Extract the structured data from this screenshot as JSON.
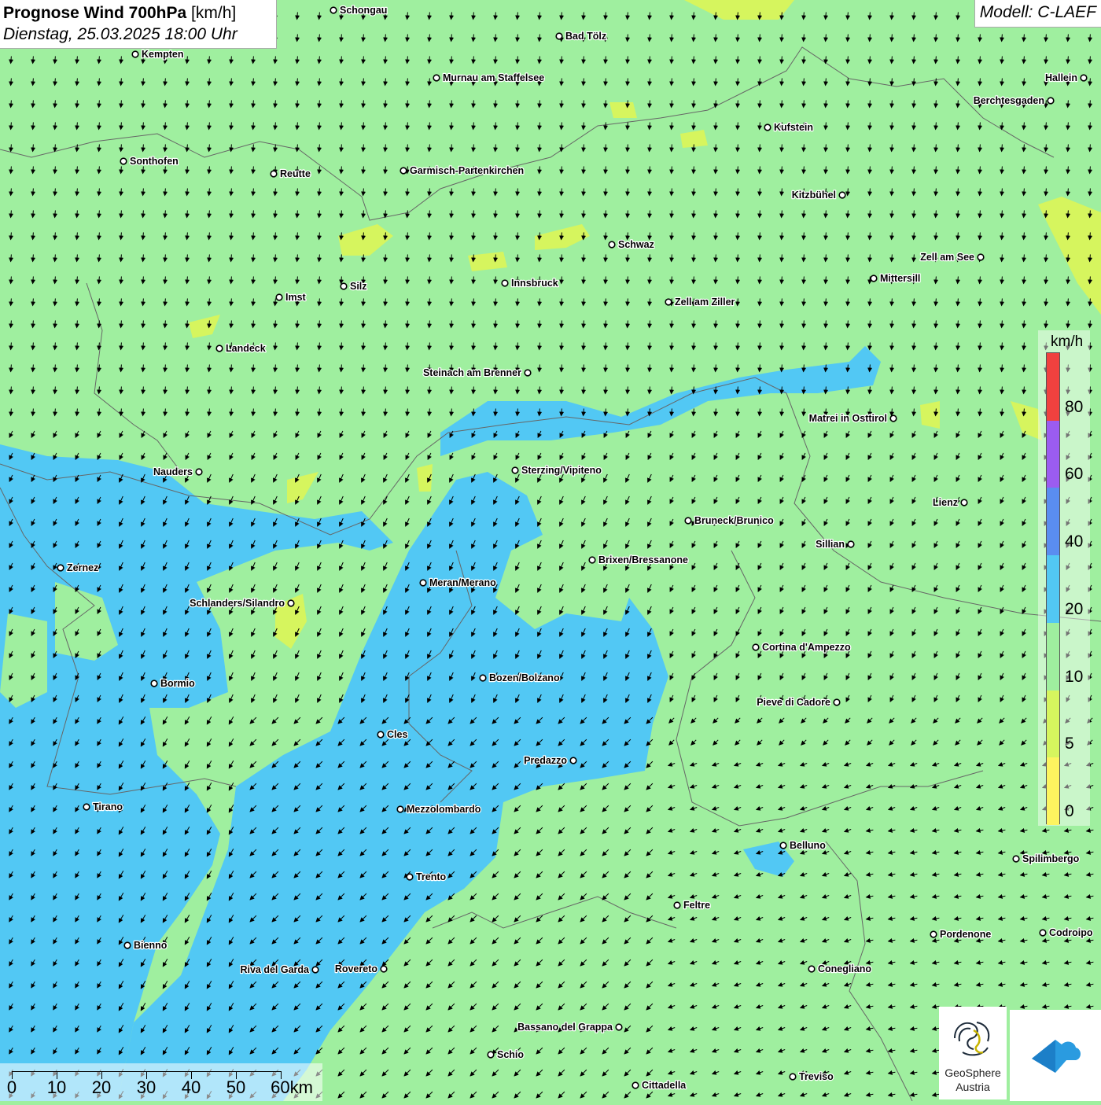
{
  "header": {
    "title_bold": "Prognose Wind 700hPa",
    "title_unit": "[km/h]",
    "datetime": "Dienstag, 25.03.2025 18:00 Uhr",
    "model": "Modell: C-LAEF"
  },
  "legend": {
    "unit": "km/h",
    "levels": [
      {
        "label": "0",
        "color": "#fdf45f"
      },
      {
        "label": "5",
        "color": "#d6f55e"
      },
      {
        "label": "10",
        "color": "#9fef9f"
      },
      {
        "label": "20",
        "color": "#52c8f4"
      },
      {
        "label": "40",
        "color": "#5a8df0"
      },
      {
        "label": "60",
        "color": "#9b5cf0"
      },
      {
        "label": "80",
        "color": "#f0413f"
      }
    ]
  },
  "scalebar": {
    "ticks": [
      "0",
      "10",
      "20",
      "30",
      "40",
      "50",
      "60km"
    ]
  },
  "cities": [
    {
      "name": "Schongau"
    },
    {
      "name": "Bad Tölz"
    },
    {
      "name": "Kempten"
    },
    {
      "name": "Murnau am Staffelsee"
    },
    {
      "name": "Hallein"
    },
    {
      "name": "Berchtesgaden"
    },
    {
      "name": "Kufstein"
    },
    {
      "name": "Sonthofen"
    },
    {
      "name": "Reutte"
    },
    {
      "name": "Garmisch-Partenkirchen"
    },
    {
      "name": "Kitzbühel"
    },
    {
      "name": "Schwaz"
    },
    {
      "name": "Zell am See"
    },
    {
      "name": "Mittersill"
    },
    {
      "name": "Innsbruck"
    },
    {
      "name": "Silz"
    },
    {
      "name": "Imst"
    },
    {
      "name": "Zell am Ziller"
    },
    {
      "name": "Landeck"
    },
    {
      "name": "Steinach am Brenner"
    },
    {
      "name": "Matrei in Osttirol"
    },
    {
      "name": "Nauders"
    },
    {
      "name": "Sterzing/Vipiteno"
    },
    {
      "name": "Lienz"
    },
    {
      "name": "Bruneck/Brunico"
    },
    {
      "name": "Sillian"
    },
    {
      "name": "Brixen/Bressanone"
    },
    {
      "name": "Zernez"
    },
    {
      "name": "Meran/Merano"
    },
    {
      "name": "Schlanders/Silandro"
    },
    {
      "name": "Cortina d'Ampezzo"
    },
    {
      "name": "Bozen/Bolzano"
    },
    {
      "name": "Bormio"
    },
    {
      "name": "Pieve di Cadore"
    },
    {
      "name": "Cles"
    },
    {
      "name": "Predazzo"
    },
    {
      "name": "Tirano"
    },
    {
      "name": "Mezzolombardo"
    },
    {
      "name": "Belluno"
    },
    {
      "name": "Spilimbergo"
    },
    {
      "name": "Trento"
    },
    {
      "name": "Feltre"
    },
    {
      "name": "Pordenone"
    },
    {
      "name": "Codroipo"
    },
    {
      "name": "Bienno"
    },
    {
      "name": "Riva del Garda"
    },
    {
      "name": "Rovereto"
    },
    {
      "name": "Conegliano"
    },
    {
      "name": "Bassano del Grappa"
    },
    {
      "name": "Schio"
    },
    {
      "name": "Treviso"
    },
    {
      "name": "Cittadella"
    }
  ],
  "logos": {
    "geosphere_line1": "GeoSphere",
    "geosphere_line2": "Austria"
  }
}
